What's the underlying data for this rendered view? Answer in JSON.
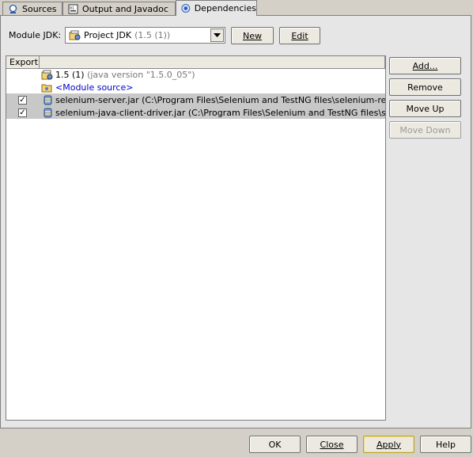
{
  "tabs": [
    {
      "label": "Sources",
      "icon": "sources-icon"
    },
    {
      "label": "Output and Javadoc",
      "icon": "output-javadoc-icon"
    },
    {
      "label": "Dependencies",
      "icon": "dependencies-icon",
      "active": true
    }
  ],
  "module_jdk": {
    "label": "Module JDK:",
    "selected_name": "Project JDK",
    "selected_detail": "(1.5 (1))",
    "new_label": "New",
    "edit_label": "Edit"
  },
  "table": {
    "columns": [
      "Export",
      ""
    ],
    "rows": [
      {
        "checked": null,
        "icon": "jdk-icon",
        "name": "1.5 (1)",
        "detail": "(java version \"1.5.0_05\")",
        "selected": false
      },
      {
        "checked": null,
        "icon": "module-source-folder-icon",
        "name": "<Module source>",
        "detail": "",
        "selected": false
      },
      {
        "checked": true,
        "icon": "jar-library-icon",
        "name": "selenium-server.jar (C:\\Program Files\\Selenium and TestNG files\\selenium-remote-contr",
        "detail": "",
        "selected": true
      },
      {
        "checked": true,
        "icon": "jar-library-icon",
        "name": "selenium-java-client-driver.jar (C:\\Program Files\\Selenium and TestNG files\\selenium-re",
        "detail": "",
        "selected": true
      }
    ]
  },
  "side_buttons": {
    "add": "Add...",
    "remove": "Remove",
    "move_up": "Move Up",
    "move_down": "Move Down"
  },
  "dialog_buttons": {
    "ok": "OK",
    "close": "Close",
    "apply": "Apply",
    "help": "Help"
  },
  "colors": {
    "panel_bg": "#e6e6e6",
    "window_bg": "#d4d0c8",
    "selection_bg": "#c8c8c8",
    "module_source_text": "#0000c8"
  }
}
